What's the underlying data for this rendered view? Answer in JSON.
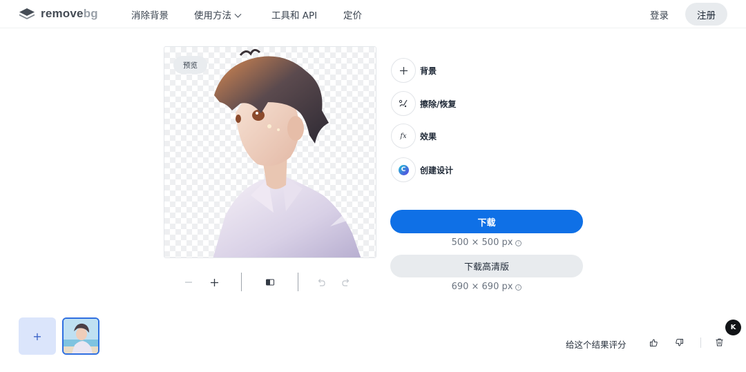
{
  "header": {
    "logo": {
      "remove": "remove",
      "bg": "bg"
    },
    "nav": {
      "remove_bg": "消除背景",
      "how_to": "使用方法",
      "tools_api": "工具和 API",
      "pricing": "定价"
    },
    "login": "登录",
    "signup": "注册"
  },
  "preview": {
    "badge": "预览"
  },
  "tools": [
    {
      "label": "背景",
      "icon": "plus-icon"
    },
    {
      "label": "擦除/恢复",
      "icon": "brush-icon"
    },
    {
      "label": "效果",
      "icon": "fx-icon"
    },
    {
      "label": "创建设计",
      "icon": "canva-icon"
    }
  ],
  "fx_glyph": "fx",
  "canva_glyph": "C",
  "download": {
    "label": "下载",
    "size": "500 × 500 px",
    "hd_label": "下载高清版",
    "hd_size": "690 × 690 px"
  },
  "info_glyph": "i",
  "bottom": {
    "add": "+",
    "rate_text": "给这个结果评分",
    "float_badge": "K"
  },
  "colors": {
    "primary": "#0f70e6",
    "secondary_button": "#e8ebee",
    "add_tile": "#dbe5fb",
    "thumb_border": "#2f6fe0"
  }
}
